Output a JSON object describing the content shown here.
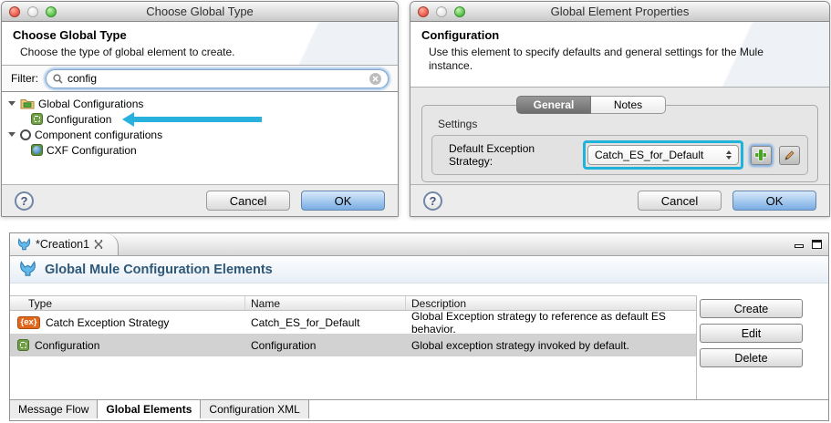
{
  "dialog_choose_global_type": {
    "window_title": "Choose Global Type",
    "heading": "Choose Global Type",
    "description": "Choose the type of global element to create.",
    "filter_label": "Filter:",
    "filter_value": "config",
    "tree": [
      {
        "label": "Global Configurations"
      },
      {
        "label": "Configuration"
      },
      {
        "label": "Component configurations"
      },
      {
        "label": "CXF Configuration"
      }
    ],
    "help_label": "?",
    "cancel_label": "Cancel",
    "ok_label": "OK"
  },
  "dialog_global_element_properties": {
    "window_title": "Global Element Properties",
    "heading": "Configuration",
    "description": "Use this element to specify defaults and general settings for the Mule instance.",
    "tab_general": "General",
    "tab_notes": "Notes",
    "settings_label": "Settings",
    "default_exception_strategy_label": "Default Exception Strategy:",
    "default_exception_strategy_value": "Catch_ES_for_Default",
    "help_label": "?",
    "cancel_label": "Cancel",
    "ok_label": "OK"
  },
  "editor": {
    "tab_title": "*Creation1",
    "heading": "Global Mule Configuration Elements",
    "table": {
      "columns": {
        "type": "Type",
        "name": "Name",
        "description": "Description"
      },
      "rows": [
        {
          "badge": "{ex}",
          "type": "Catch Exception Strategy",
          "name": "Catch_ES_for_Default",
          "description": "Global Exception strategy to reference as default ES behavior."
        },
        {
          "type": "Configuration",
          "name": "Configuration",
          "description": "Global exception strategy invoked by default."
        }
      ]
    },
    "actions": {
      "create": "Create",
      "edit": "Edit",
      "delete": "Delete"
    },
    "bottom_tabs": {
      "message_flow": "Message Flow",
      "global_elements": "Global Elements",
      "configuration_xml": "Configuration XML"
    }
  },
  "colors": {
    "highlight_cyan": "#1fb3dc",
    "ok_button_blue": "#79ace3",
    "ex_badge_orange": "#e2671c",
    "configuration_green": "#6f9e44"
  }
}
